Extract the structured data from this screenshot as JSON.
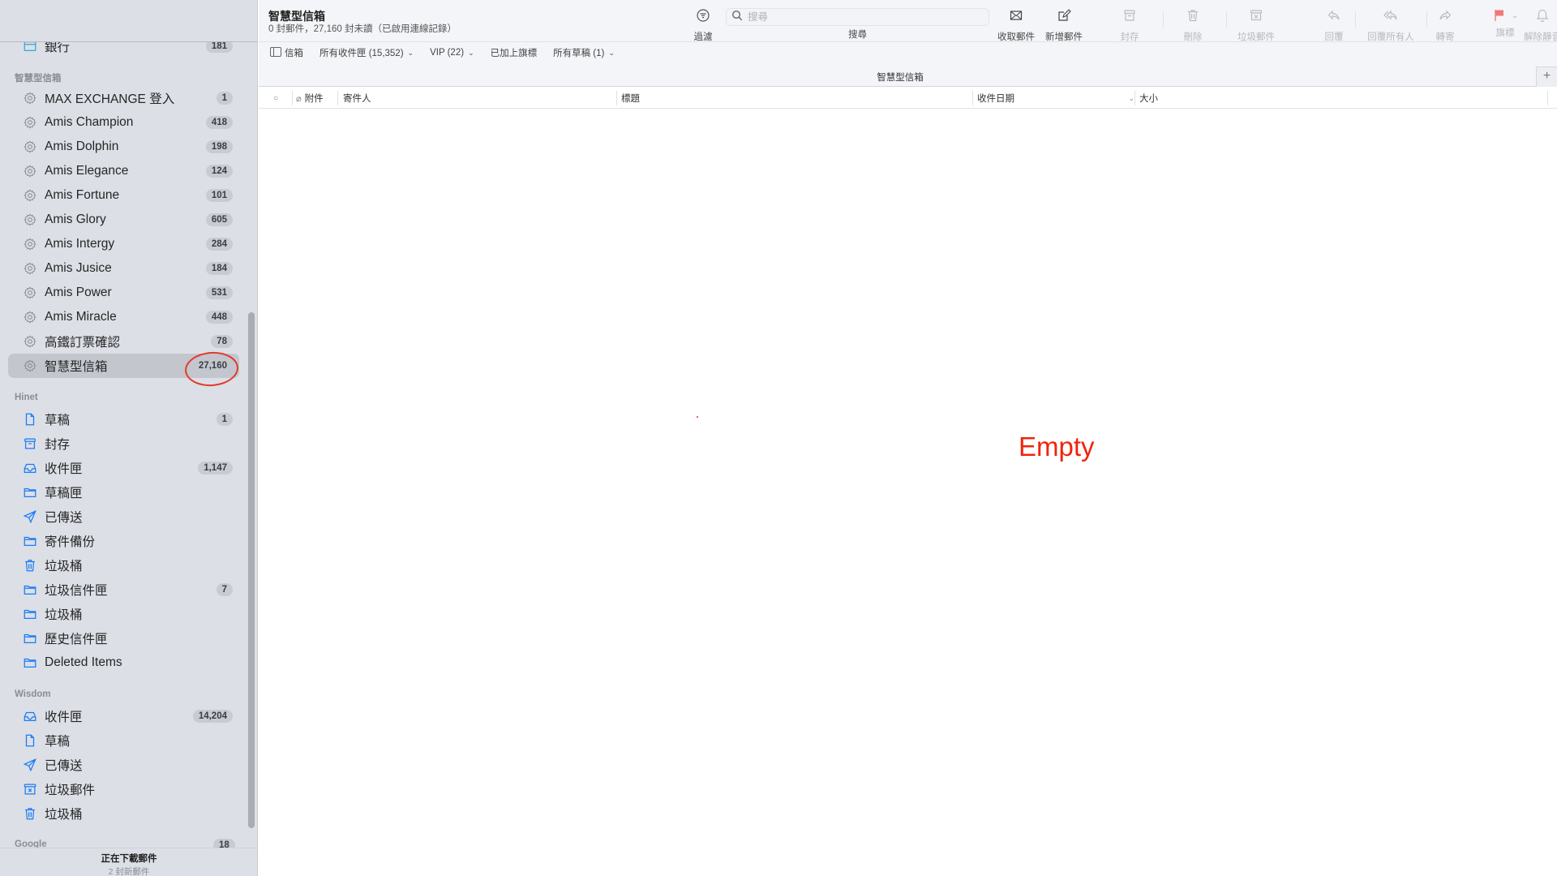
{
  "window": {
    "title": "智慧型信箱",
    "subtitle": "0 封郵件，27,160 封未讀（已啟用連線記錄）"
  },
  "toolbar": {
    "filter_label": "過濾",
    "search_label": "搜尋",
    "search_placeholder": "搜尋",
    "search_value": "",
    "get_mail_label": "收取郵件",
    "new_message_label": "新增郵件",
    "archive_label": "封存",
    "delete_label": "刪除",
    "junk_label": "垃圾郵件",
    "reply_label": "回覆",
    "reply_all_label": "回覆所有人",
    "forward_label": "轉寄",
    "flag_label": "旗標",
    "unmute_label": "解除靜音",
    "flag_color": "#f07878"
  },
  "favorites": [
    {
      "label": "信箱",
      "icon": "sidebar-icon",
      "has_chevron": false
    },
    {
      "label": "所有收件匣 (15,352)",
      "has_chevron": true
    },
    {
      "label": "VIP (22)",
      "has_chevron": true
    },
    {
      "label": "已加上旗標",
      "has_chevron": false
    },
    {
      "label": "所有草稿 (1)",
      "has_chevron": true
    }
  ],
  "list": {
    "title": "智慧型信箱",
    "add_column": "+",
    "columns": {
      "unread": "○",
      "attachment": "附件",
      "from": "寄件人",
      "subject": "標題",
      "date_received": "收件日期",
      "size": "大小"
    },
    "empty_annotation": "Empty"
  },
  "sidebar": {
    "top_partial_item": {
      "label": "銀行",
      "count": "181"
    },
    "sections": [
      {
        "title": "智慧型信箱",
        "items": [
          {
            "label": "MAX EXCHANGE 登入",
            "count": "1",
            "icon": "gear"
          },
          {
            "label": "Amis Champion",
            "count": "418",
            "icon": "gear"
          },
          {
            "label": "Amis Dolphin",
            "count": "198",
            "icon": "gear"
          },
          {
            "label": "Amis Elegance",
            "count": "124",
            "icon": "gear"
          },
          {
            "label": "Amis Fortune",
            "count": "101",
            "icon": "gear"
          },
          {
            "label": "Amis Glory",
            "count": "605",
            "icon": "gear"
          },
          {
            "label": "Amis Intergy",
            "count": "284",
            "icon": "gear"
          },
          {
            "label": "Amis Jusice",
            "count": "184",
            "icon": "gear"
          },
          {
            "label": "Amis Power",
            "count": "531",
            "icon": "gear"
          },
          {
            "label": "Amis Miracle",
            "count": "448",
            "icon": "gear"
          },
          {
            "label": "高鐵訂票確認",
            "count": "78",
            "icon": "gear"
          },
          {
            "label": "智慧型信箱",
            "count": "27,160",
            "icon": "gear",
            "selected": true
          }
        ]
      },
      {
        "title": "Hinet",
        "items": [
          {
            "label": "草稿",
            "count": "1",
            "icon": "doc"
          },
          {
            "label": "封存",
            "count": "",
            "icon": "archive"
          },
          {
            "label": "收件匣",
            "count": "1,147",
            "icon": "inbox"
          },
          {
            "label": "草稿匣",
            "count": "",
            "icon": "folder"
          },
          {
            "label": "已傳送",
            "count": "",
            "icon": "send"
          },
          {
            "label": "寄件備份",
            "count": "",
            "icon": "folder"
          },
          {
            "label": "垃圾桶",
            "count": "",
            "icon": "trash"
          },
          {
            "label": "垃圾信件匣",
            "count": "7",
            "icon": "folder"
          },
          {
            "label": "垃圾桶",
            "count": "",
            "icon": "folder"
          },
          {
            "label": "歷史信件匣",
            "count": "",
            "icon": "folder"
          },
          {
            "label": "Deleted Items",
            "count": "",
            "icon": "folder"
          }
        ]
      },
      {
        "title": "Wisdom",
        "items": [
          {
            "label": "收件匣",
            "count": "14,204",
            "icon": "inbox"
          },
          {
            "label": "草稿",
            "count": "",
            "icon": "doc"
          },
          {
            "label": "已傳送",
            "count": "",
            "icon": "send"
          },
          {
            "label": "垃圾郵件",
            "count": "",
            "icon": "junk"
          },
          {
            "label": "垃圾桶",
            "count": "",
            "icon": "trash"
          }
        ]
      },
      {
        "title": "Google",
        "count": "18",
        "items": []
      }
    ],
    "footer": {
      "status": "正在下載郵件",
      "detail": "2 封新郵件"
    },
    "accent_color": "#1a7cf5",
    "annotation_color": "#e23a2a"
  }
}
